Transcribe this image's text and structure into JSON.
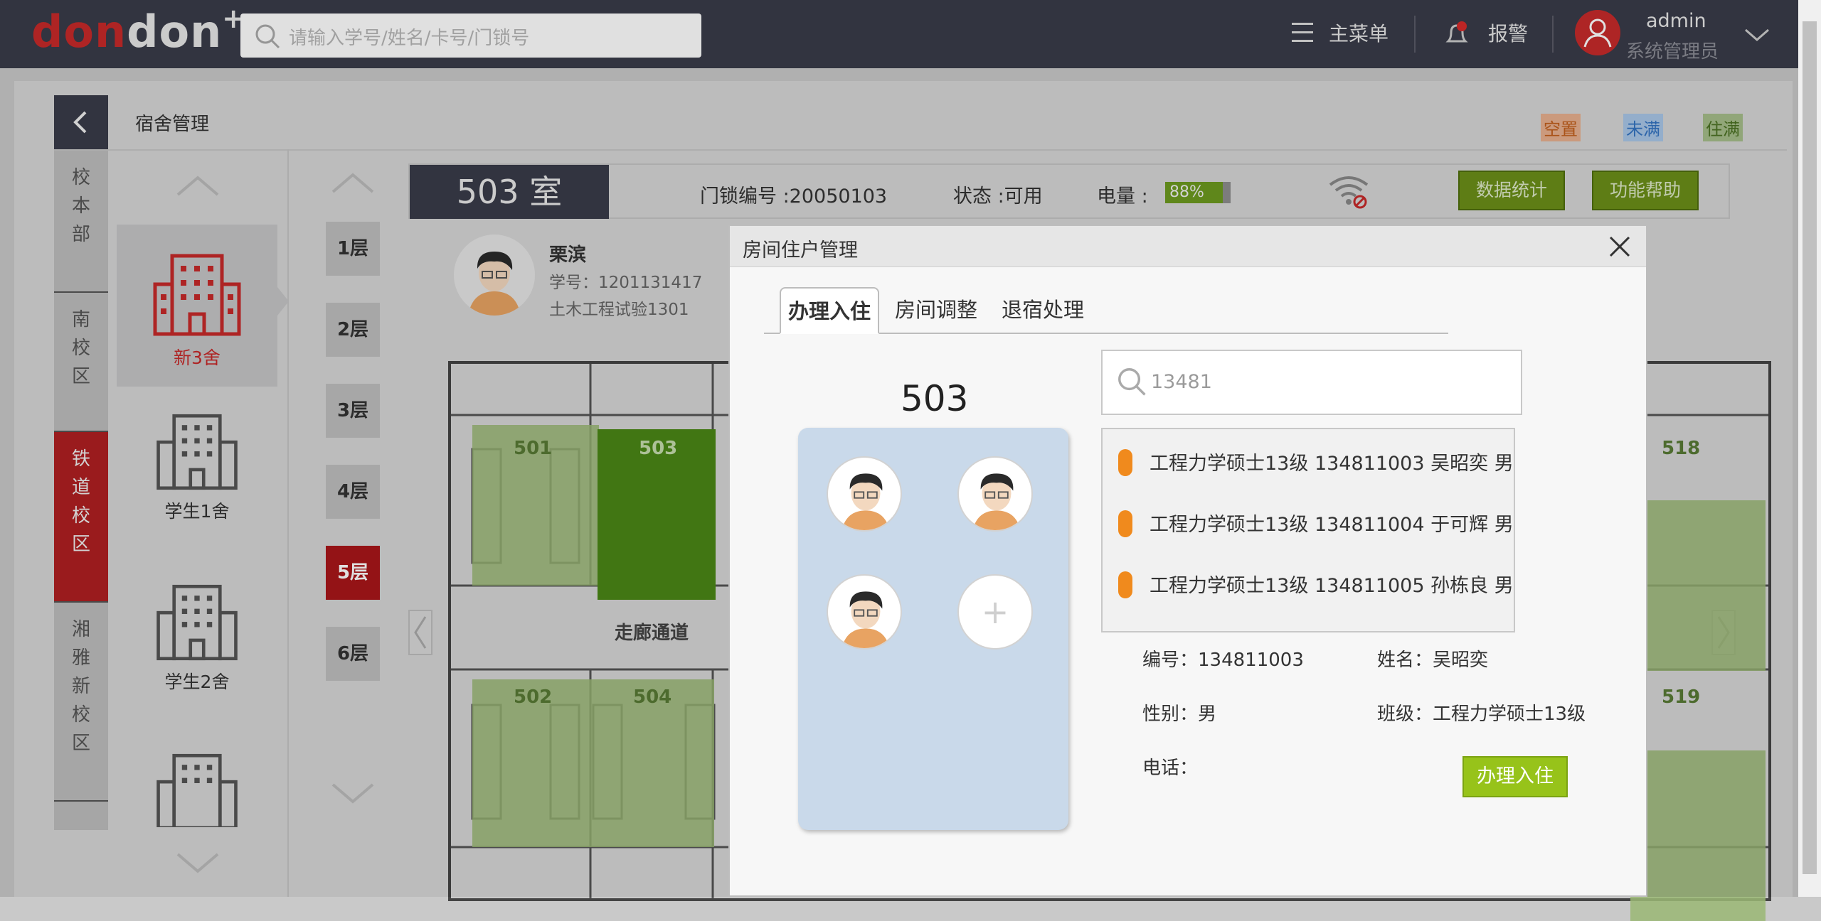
{
  "topbar": {
    "logo_part1": "don",
    "logo_part2": "don",
    "logo_plus": "+",
    "search_placeholder": "请输入学号/姓名/卡号/门锁号",
    "menu_label": "主菜单",
    "alarm_label": "报警",
    "user_name": "admin",
    "user_role": "系统管理员"
  },
  "page": {
    "title": "宿舍管理",
    "legend": {
      "empty": "空置",
      "partial": "未满",
      "full": "住满"
    }
  },
  "campuses": [
    {
      "label": "校本部",
      "active": false
    },
    {
      "label": "南校区",
      "active": false
    },
    {
      "label": "铁道校区",
      "active": true
    },
    {
      "label": "湘雅新校区",
      "active": false
    }
  ],
  "buildings": [
    {
      "name": "新3舍",
      "selected": true
    },
    {
      "name": "学生1舍",
      "selected": false
    },
    {
      "name": "学生2舍",
      "selected": false
    }
  ],
  "floors": [
    "1层",
    "2层",
    "3层",
    "4层",
    "5层",
    "6层"
  ],
  "active_floor": "5层",
  "room": {
    "number": "503 室",
    "lock_label": "门锁编号 :20050103",
    "status_label": "状态 :可用",
    "battery_label": "电量 :",
    "battery_value": "88%",
    "battery_level": 0.88,
    "stats_button": "数据统计",
    "help_button": "功能帮助"
  },
  "occupant": {
    "name": "栗滨",
    "student_no": "学号：1201131417",
    "class": "土木工程试验1301"
  },
  "plan": {
    "rooms": [
      "501",
      "503",
      "502",
      "504",
      "518",
      "519"
    ],
    "corridor": "走廊通道"
  },
  "modal": {
    "title": "房间住户管理",
    "tabs": [
      "办理入住",
      "房间调整",
      "退宿处理"
    ],
    "active_tab": "办理入住",
    "room_no": "503",
    "add_symbol": "+",
    "search_value": "13481",
    "results": [
      "工程力学硕士13级 134811003 吴昭奕 男",
      "工程力学硕士13级 134811004 于可辉 男",
      "工程力学硕士13级 134811005 孙栋良 男"
    ],
    "detail": {
      "id": "编号：134811003",
      "name": "姓名：吴昭奕",
      "gender": "性别：男",
      "class": "班级：工程力学硕士13级",
      "phone": "电话："
    },
    "checkin_button": "办理入住"
  }
}
